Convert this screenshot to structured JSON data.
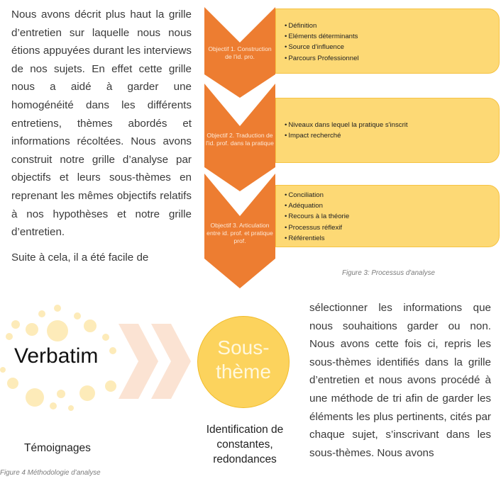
{
  "paragraph_top": [
    "Nous avons décrit plus haut la grille d’entretien sur laquelle nous nous étions appuyées durant les interviews de nos sujets. En effet cette grille nous a aidé à garder une homogénéité dans les différents entretiens, thèmes abordés et informations récoltées. Nous avons construit notre grille d’analyse par objectifs et leurs sous-thèmes en reprenant les mêmes objectifs relatifs à nos hypothèses et notre grille d’entretien.",
    "Suite à cela, il a été facile de"
  ],
  "paragraph_bottom": "sélectionner les informations que nous souhaitions garder ou non. Nous avons cette fois ci, repris les sous-thèmes identifiés dans la grille d’entretien et nous avons procédé à une méthode de tri afin de garder les éléments les plus pertinents, cités par chaque sujet, s’inscrivant dans les sous-thèmes. Nous avons",
  "figure3": {
    "caption": "Figure 3: Processus d'analyse",
    "colors": {
      "chevron": "#ed7d31",
      "box": "#fdd975",
      "box_border": "#f6c343"
    },
    "objectives": [
      {
        "label": "Objectif 1. Construction de l'id. pro.",
        "items": [
          "Définition",
          "Eléments déterminants",
          "Source d'influence",
          "Parcours Professionnel"
        ]
      },
      {
        "label": "Objectif 2. Traduction de l'id. prof. dans la pratique",
        "items": [
          "Niveaux dans lequel la pratique s'inscrit",
          "Impact recherché"
        ]
      },
      {
        "label": "Objectif 3. Articulation entre id. prof. et pratique prof.",
        "items": [
          "Conciliation",
          "Adéquation",
          "Recours à la théorie",
          "Processus réflexif",
          "Référentiels"
        ]
      }
    ]
  },
  "figure4": {
    "caption": "Figure 4 Méthodologie d’analyse",
    "left_title": "Verbatim",
    "left_subtitle": "Témoignages",
    "circle_line1": "Sous-",
    "circle_line2": "thème",
    "right_subtitle": "Identification de constantes, redondances",
    "colors": {
      "dots": "#fdebb9",
      "arrows": "#fbe3d3",
      "circle": "#fcd35d"
    }
  }
}
